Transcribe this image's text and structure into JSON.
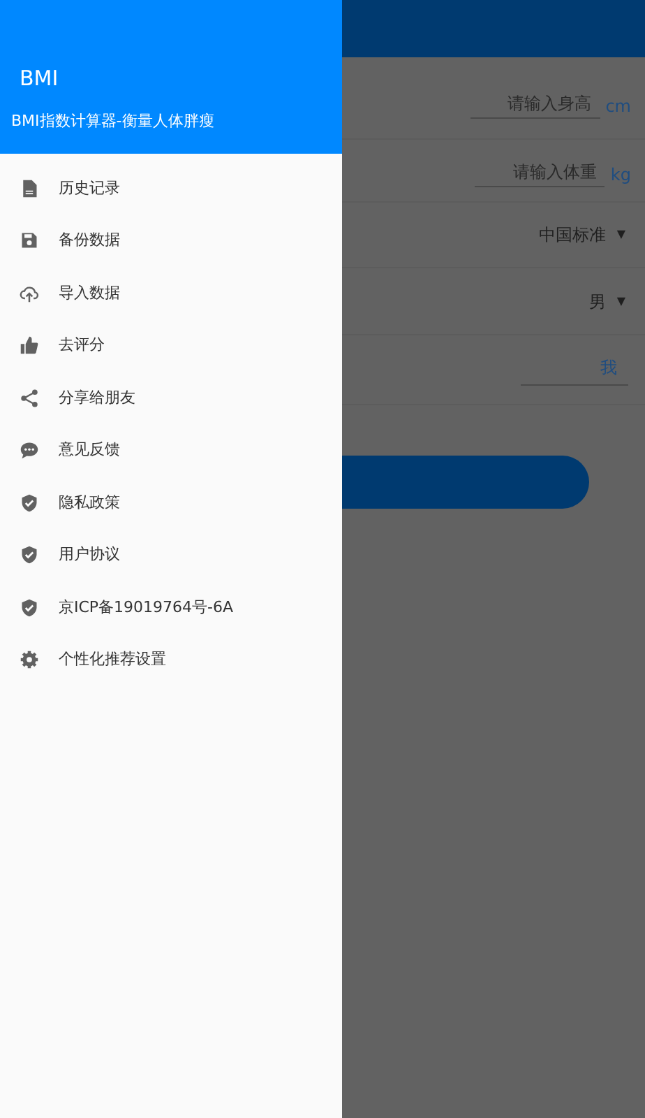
{
  "background_form": {
    "height_field": {
      "placeholder": "请输入身高",
      "unit": "cm"
    },
    "weight_field": {
      "placeholder": "请输入体重",
      "unit": "kg"
    },
    "standard_dropdown": {
      "value": "中国标准",
      "caret": "▼"
    },
    "gender_dropdown": {
      "value": "男",
      "caret": "▼"
    },
    "name_field": {
      "value": "我"
    }
  },
  "drawer": {
    "title": "BMI",
    "subtitle": "BMI指数计算器-衡量人体胖瘦",
    "items": [
      {
        "label": "历史记录"
      },
      {
        "label": "备份数据"
      },
      {
        "label": "导入数据"
      },
      {
        "label": "去评分"
      },
      {
        "label": "分享给朋友"
      },
      {
        "label": "意见反馈"
      },
      {
        "label": "隐私政策"
      },
      {
        "label": "用户协议"
      },
      {
        "label": "京ICP备19019764号-6A"
      },
      {
        "label": "个性化推荐设置"
      }
    ]
  }
}
